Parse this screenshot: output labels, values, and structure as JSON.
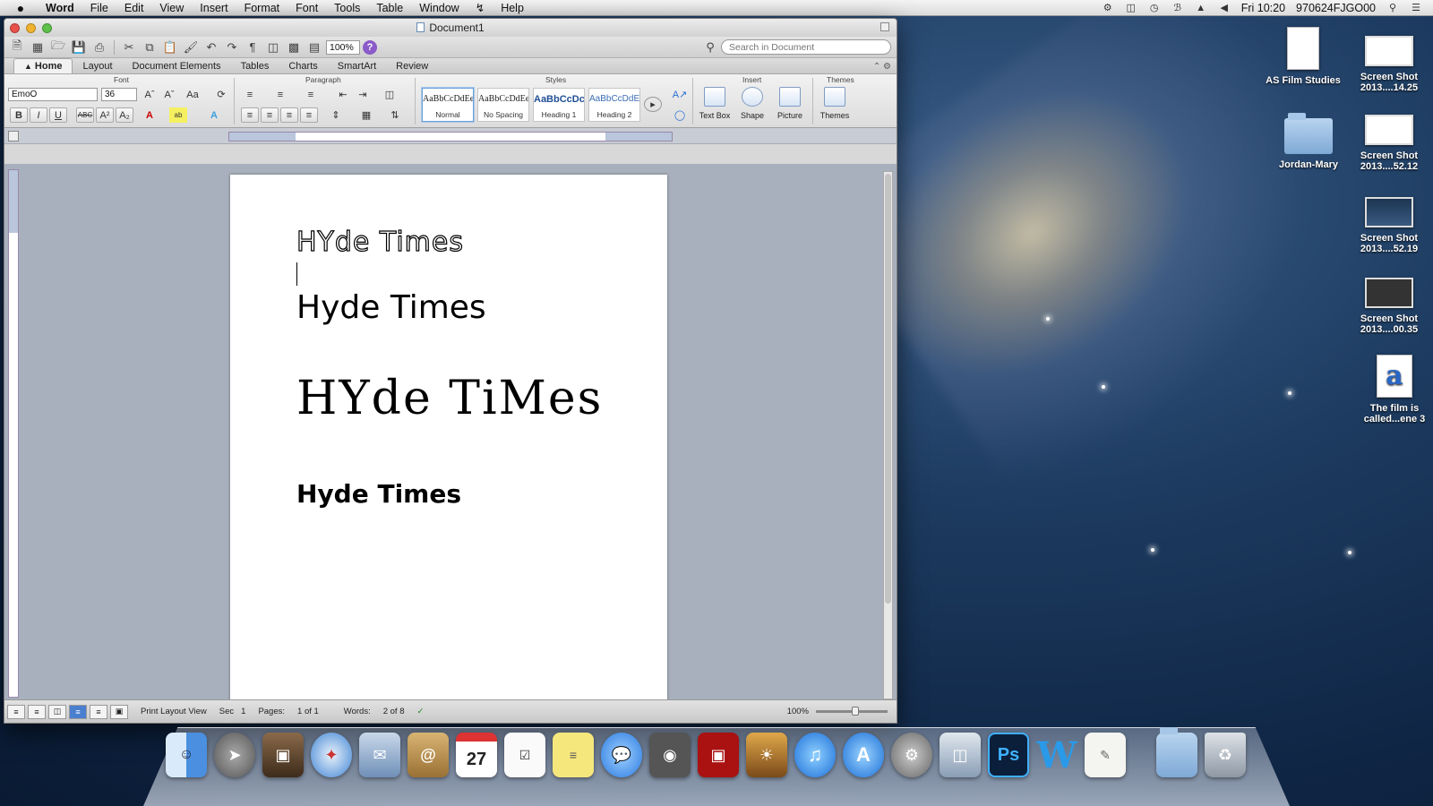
{
  "menubar": {
    "apple": "",
    "items": [
      "Word",
      "File",
      "Edit",
      "View",
      "Insert",
      "Format",
      "Font",
      "Tools",
      "Table",
      "Window",
      "Help"
    ],
    "clock": "Fri 10:20",
    "user": "970624FJGO00"
  },
  "window": {
    "title": "Document1",
    "zoom": "100%",
    "search_placeholder": "Search in Document"
  },
  "ribbon": {
    "tabs": [
      "Home",
      "Layout",
      "Document Elements",
      "Tables",
      "Charts",
      "SmartArt",
      "Review"
    ],
    "groups": {
      "font": "Font",
      "paragraph": "Paragraph",
      "styles": "Styles",
      "insert": "Insert",
      "themes": "Themes"
    },
    "font_name": "EmoO",
    "font_size": "36",
    "styles": [
      {
        "sample": "AaBbCcDdEe",
        "name": "Normal"
      },
      {
        "sample": "AaBbCcDdEe",
        "name": "No Spacing"
      },
      {
        "sample": "AaBbCcDc",
        "name": "Heading 1"
      },
      {
        "sample": "AaBbCcDdEe",
        "name": "Heading 2"
      }
    ],
    "insert_buttons": [
      "Text Box",
      "Shape",
      "Picture"
    ],
    "themes_button": "Themes"
  },
  "document": {
    "lines": [
      "HYde Times",
      "Hyde Times",
      "HYde TiMes",
      "Hyde Times"
    ]
  },
  "status": {
    "view": "Print Layout View",
    "sec_label": "Sec",
    "sec": "1",
    "pages_label": "Pages:",
    "pages": "1 of 1",
    "words_label": "Words:",
    "words": "2 of 8",
    "zoom": "100%"
  },
  "desktop_icons": [
    {
      "label": "AS Film Studies"
    },
    {
      "label": "Jordan-Mary"
    },
    {
      "label": "Screen Shot 2013....14.25"
    },
    {
      "label": "Screen Shot 2013....52.12"
    },
    {
      "label": "Screen Shot 2013....52.19"
    },
    {
      "label": "Screen Shot 2013....00.35"
    },
    {
      "label": "The film is called...ene 3"
    }
  ],
  "dock": {
    "calendar_day": "27",
    "photoshop": "Ps",
    "word": "W"
  }
}
